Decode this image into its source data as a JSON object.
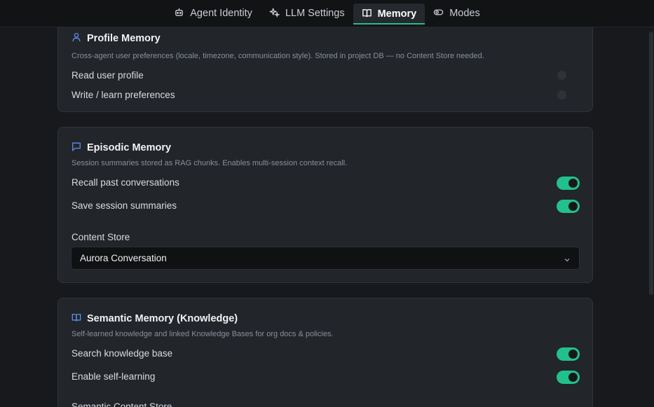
{
  "tabs": [
    {
      "label": "Agent Identity",
      "icon": "bot-icon",
      "active": false
    },
    {
      "label": "LLM Settings",
      "icon": "sparkles-icon",
      "active": false
    },
    {
      "label": "Memory",
      "icon": "book-icon",
      "active": true
    },
    {
      "label": "Modes",
      "icon": "toggle-icon",
      "active": false
    }
  ],
  "colors": {
    "accent": "#22c08a",
    "icon_blue": "#5b8def",
    "background": "#17191d",
    "card": "#22252a"
  },
  "profile": {
    "title": "Profile Memory",
    "icon": "user-icon",
    "description": "Cross-agent user preferences (locale, timezone, communication style). Stored in project DB — no Content Store needed.",
    "rows": [
      {
        "label": "Read user profile",
        "enabled": false
      },
      {
        "label": "Write / learn preferences",
        "enabled": false
      }
    ]
  },
  "episodic": {
    "title": "Episodic Memory",
    "icon": "message-square-icon",
    "description": "Session summaries stored as RAG chunks. Enables multi-session context recall.",
    "rows": [
      {
        "label": "Recall past conversations",
        "enabled": true
      },
      {
        "label": "Save session summaries",
        "enabled": true
      }
    ],
    "store_label": "Content Store",
    "store_value": "Aurora Conversation"
  },
  "semantic": {
    "title": "Semantic Memory (Knowledge)",
    "icon": "book-open-icon",
    "description": "Self-learned knowledge and linked Knowledge Bases for org docs & policies.",
    "rows": [
      {
        "label": "Search knowledge base",
        "enabled": true
      },
      {
        "label": "Enable self-learning",
        "enabled": true
      }
    ],
    "store_label": "Semantic Content Store"
  }
}
